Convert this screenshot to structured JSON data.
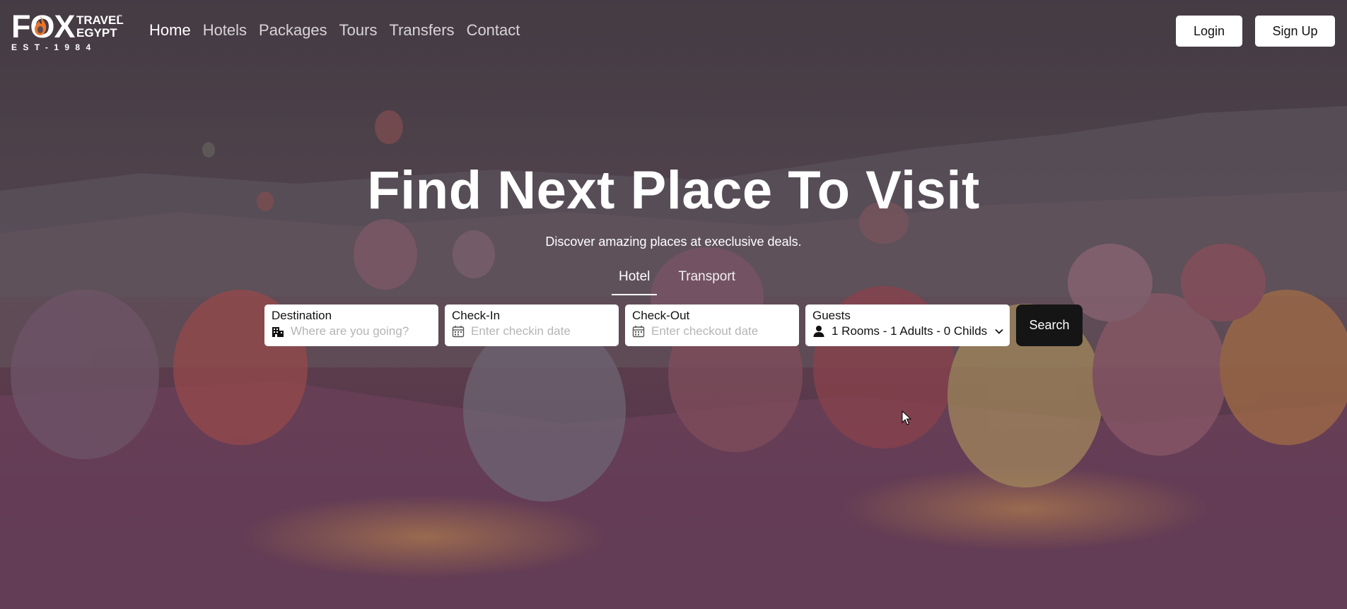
{
  "brand": {
    "logo_text": "FOX",
    "logo_sub_line1": "TRAVEL",
    "logo_sub_line2": "EGYPT",
    "logo_tm": "™",
    "logo_est": "EST-1984"
  },
  "nav": {
    "items": [
      {
        "label": "Home",
        "active": true
      },
      {
        "label": "Hotels",
        "active": false
      },
      {
        "label": "Packages",
        "active": false
      },
      {
        "label": "Tours",
        "active": false
      },
      {
        "label": "Transfers",
        "active": false
      },
      {
        "label": "Contact",
        "active": false
      }
    ],
    "login_label": "Login",
    "signup_label": "Sign Up"
  },
  "hero": {
    "title": "Find Next Place To Visit",
    "subtitle": "Discover amazing places at execlusive deals."
  },
  "tabs": [
    {
      "label": "Hotel",
      "active": true
    },
    {
      "label": "Transport",
      "active": false
    }
  ],
  "search": {
    "destination_label": "Destination",
    "destination_placeholder": "Where are you going?",
    "checkin_label": "Check-In",
    "checkin_placeholder": "Enter checkin date",
    "checkout_label": "Check-Out",
    "checkout_placeholder": "Enter checkout date",
    "guests_label": "Guests",
    "guests_value": "1 Rooms - 1 Adults - 0 Childs",
    "search_label": "Search"
  },
  "colors": {
    "accent_orange": "#e8762b",
    "search_button": "#151515",
    "text_white": "#ffffff"
  },
  "icons": {
    "destination": "building-icon",
    "checkin": "calendar-icon",
    "checkout": "calendar-icon",
    "guests": "user-icon",
    "dropdown": "chevron-down-icon"
  }
}
